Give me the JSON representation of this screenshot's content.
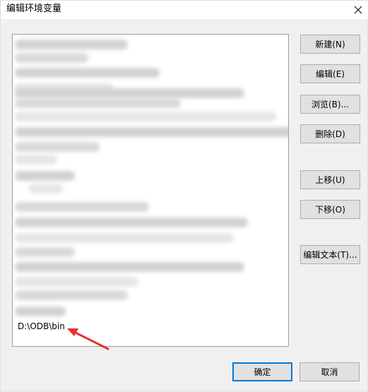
{
  "window": {
    "title": "编辑环境变量",
    "close_glyph": "✕"
  },
  "list": {
    "visible_entry": "D:\\ODB\\bin",
    "redacted_rows": 20
  },
  "buttons": {
    "new": "新建(N)",
    "edit": "编辑(E)",
    "browse": "浏览(B)...",
    "delete": "删除(D)",
    "move_up": "上移(U)",
    "move_down": "下移(O)",
    "edit_text": "编辑文本(T)..."
  },
  "footer": {
    "ok": "确定",
    "cancel": "取消"
  },
  "annotation": {
    "arrow_color": "#e8302a"
  }
}
